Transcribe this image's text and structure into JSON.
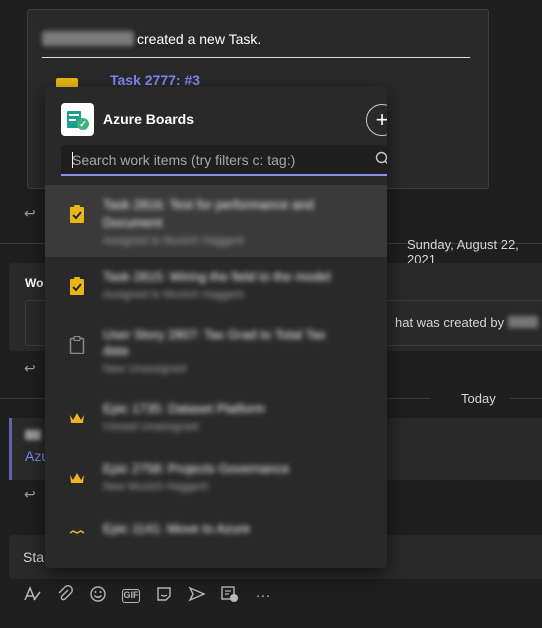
{
  "chat": {
    "card1": {
      "action": "created a new Task.",
      "task_title": "Task 2777: #3"
    },
    "date_divider": "Sunday, August 22, 2021",
    "card2": {
      "prefix": "Wo",
      "created_text": "hat was created by"
    },
    "today_divider": "Today",
    "card3": {
      "prefix": "Azu"
    },
    "compose": {
      "prefix": "Sta"
    }
  },
  "toolbar": {
    "items": [
      "format-icon",
      "attach-icon",
      "emoji-icon",
      "gif-icon",
      "sticker-icon",
      "meet-icon",
      "azure-boards-icon",
      "more-icon"
    ],
    "gif_label": "GIF",
    "more_label": "···"
  },
  "popup": {
    "title": "Azure Boards",
    "search_placeholder": "Search work items (try filters c: tag:)",
    "add_label": "+",
    "items": [
      {
        "type": "task",
        "title": "Task 2816: Test for performance and",
        "title2": "Document",
        "subtitle": "Assigned to Munich Haggerti",
        "selected": true
      },
      {
        "type": "task",
        "title": "Task 2815: Wiring the field to the model",
        "subtitle": "Assigned to Munich Haggerti",
        "selected": false
      },
      {
        "type": "story",
        "title": "User Story 2807: Tax Grad to Total Tax",
        "title2": "data",
        "subtitle": "New Unassigned",
        "selected": false
      },
      {
        "type": "epic",
        "title": "Epic 1735: Dataset Platform",
        "subtitle": "Closed Unassigned",
        "selected": false
      },
      {
        "type": "epic",
        "title": "Epic 2758: Projects Governance",
        "subtitle": "New Munich Haggerti",
        "selected": false
      },
      {
        "type": "epic",
        "title": "Epic 1141: Move to Azure",
        "subtitle": "",
        "selected": false
      }
    ]
  },
  "colors": {
    "background": "#1f1f1f",
    "card": "#292929",
    "popup": "#292929",
    "accent": "#7f85f5",
    "task_icon": "#e8b717",
    "epic_icon": "#f0b323"
  }
}
